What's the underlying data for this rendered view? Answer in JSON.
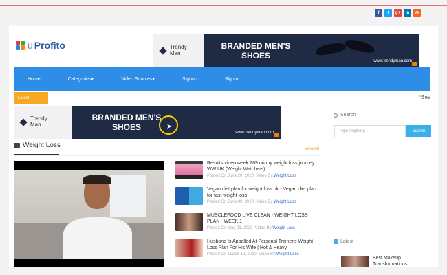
{
  "social": [
    {
      "icon": "facebook-icon",
      "glyph": "f",
      "color": "#3b5998"
    },
    {
      "icon": "twitter-icon",
      "glyph": "t",
      "color": "#1da1f2"
    },
    {
      "icon": "google-plus-icon",
      "glyph": "g+",
      "color": "#dd4b39"
    },
    {
      "icon": "linkedin-icon",
      "glyph": "in",
      "color": "#0077b5"
    },
    {
      "icon": "rss-icon",
      "glyph": "◎",
      "color": "#f26522"
    }
  ],
  "logo": {
    "prefix": "u",
    "name": "Profito"
  },
  "banner": {
    "brand_line1": "Trendy",
    "brand_line2": "Man",
    "headline_line1": "BRANDED MEN'S",
    "headline_line2": "SHOES",
    "url": "www.trendyman.com"
  },
  "nav": [
    "Home",
    "Categories▾",
    "Video Sources▾",
    "Signup",
    "Signin"
  ],
  "latest_tab": "Latest",
  "ticker": "*Bes",
  "section": {
    "title": "Weight Loss",
    "view_all": "View All"
  },
  "posts": [
    {
      "title": "Results video week 269 on my weight loss journey WW UK (Weight Watchers)",
      "posted_label": "Posted On:",
      "date": "June 20, 2020",
      "video_by_label": "Video By:",
      "author": "Weight Loss"
    },
    {
      "title": "Vegan diet plan for weight loss uk - Vegan diet plan for fast weight loss",
      "posted_label": "Posted On:",
      "date": "June 09, 2020",
      "video_by_label": "Video By:",
      "author": "Weight Loss"
    },
    {
      "title": "MUSCLEFOOD LIVE CLEAN - WEIGHT LOSS PLAN - WEEK 1",
      "posted_label": "Posted On:",
      "date": "May 23, 2020",
      "video_by_label": "Video By:",
      "author": "Weight Loss"
    },
    {
      "title": "Husband Is Appalled At Personal Trainer's Weight Loss Plan For His Wife | Hot & Heavy",
      "posted_label": "Posted On:",
      "date": "March 12, 2020",
      "video_by_label": "Video By:",
      "author": "Weight Loss"
    }
  ],
  "search": {
    "label": "Search",
    "placeholder": "Type Anything",
    "button": "Search"
  },
  "sidebar_latest": {
    "label": "Latest",
    "item_title": "Best Makeup Transformations"
  },
  "colors": {
    "nav": "#2e8de6",
    "accent": "#f9a825",
    "link": "#2e6fc9"
  }
}
